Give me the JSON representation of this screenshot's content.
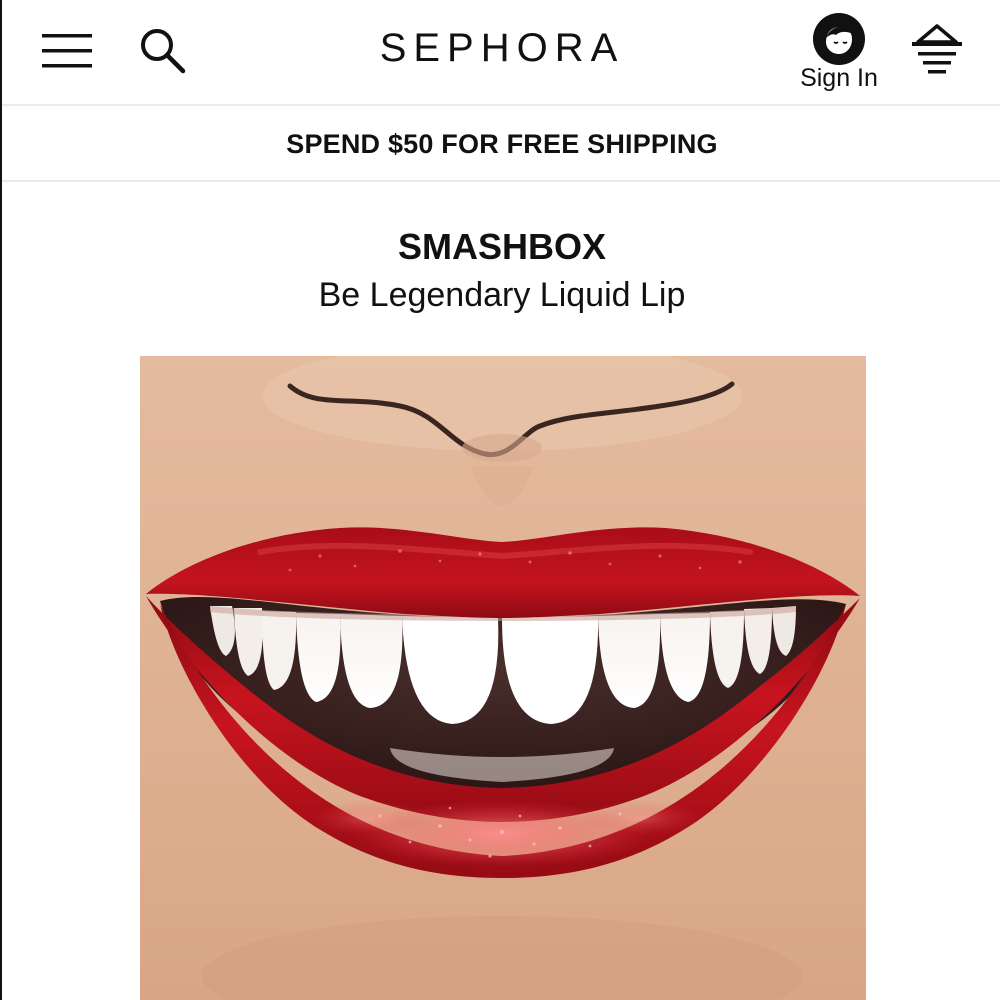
{
  "header": {
    "logo_text": "SEPHORA",
    "signin_label": "Sign In",
    "icons": {
      "menu": "hamburger-menu-icon",
      "search": "search-icon",
      "account": "account-avatar-icon",
      "basket": "basket-icon"
    }
  },
  "promo": {
    "text": "SPEND $50 FOR FREE SHIPPING"
  },
  "product": {
    "brand": "SMASHBOX",
    "name": "Be Legendary Liquid Lip",
    "image": "product-lips-image"
  },
  "colors": {
    "text": "#111111",
    "lip_red": "#b5111c",
    "skin": "#e0b497"
  }
}
